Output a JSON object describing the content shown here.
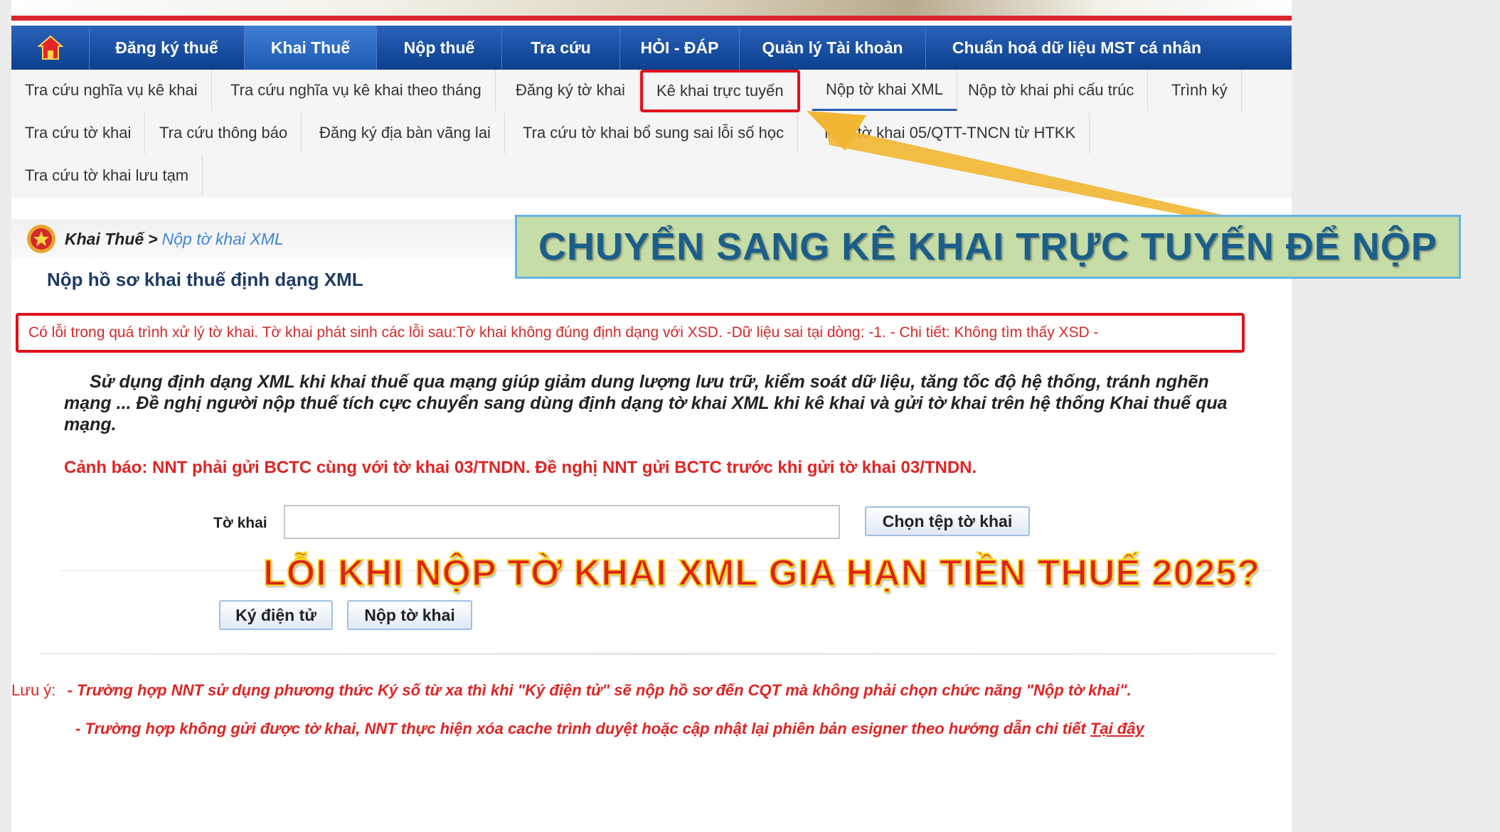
{
  "main_nav": {
    "home_icon": "house-icon",
    "items": [
      {
        "label": "Đăng ký thuế"
      },
      {
        "label": "Khai Thuế"
      },
      {
        "label": "Nộp thuế"
      },
      {
        "label": "Tra cứu"
      },
      {
        "label": "HỎI - ĐÁP"
      },
      {
        "label": "Quản lý Tài khoản"
      },
      {
        "label": "Chuẩn hoá dữ liệu MST cá nhân"
      }
    ]
  },
  "sub_nav": {
    "items": [
      {
        "label": "Tra cứu nghĩa vụ kê khai"
      },
      {
        "label": "Tra cứu nghĩa vụ kê khai theo tháng"
      },
      {
        "label": "Đăng ký tờ khai"
      },
      {
        "label": "Kê khai trực tuyến"
      },
      {
        "label": "Nộp tờ khai XML"
      },
      {
        "label": "Nộp tờ khai phi cấu trúc"
      },
      {
        "label": "Trình ký"
      },
      {
        "label": "Tra cứu tờ khai"
      },
      {
        "label": "Tra cứu thông báo"
      },
      {
        "label": "Đăng ký địa bàn vãng lai"
      },
      {
        "label": "Tra cứu tờ khai bổ sung sai lỗi số học"
      },
      {
        "label": "Nộp tờ khai 05/QTT-TNCN từ HTKK"
      },
      {
        "label": "Tra cứu tờ khai lưu tạm"
      }
    ]
  },
  "breadcrumb": {
    "icon": "emblem-icon",
    "root": "Khai Thuế",
    "separator": ">",
    "current": "Nộp tờ khai XML"
  },
  "page_title": "Nộp hồ sơ khai thuế định dạng XML",
  "error_message": "Có lỗi trong quá trình xử lý tờ khai. Tờ khai phát sinh các lỗi sau:Tờ khai không đúng định dạng với XSD. -Dữ liệu sai tại dòng: -1. - Chi tiết: Không tìm thấy XSD -",
  "description": "Sử dụng định dạng XML khi khai thuế qua mạng giúp giảm dung lượng lưu trữ, kiểm soát dữ liệu, tăng tốc độ hệ thống, tránh nghẽn mạng ... Đề nghị người nộp thuế tích cực chuyển sang dùng định dạng tờ khai XML khi kê khai và gửi tờ khai trên hệ thống Khai thuế qua mạng.",
  "warning": "Cảnh báo: NNT phải gửi BCTC cùng với tờ khai 03/TNDN. Đề nghị NNT gửi BCTC trước khi gửi tờ khai 03/TNDN.",
  "form": {
    "file_label": "Tờ khai",
    "file_value": "",
    "choose_button": "Chọn tệp tờ khai",
    "sign_button": "Ký điện tử",
    "submit_button": "Nộp tờ khai"
  },
  "notes": {
    "label": "Lưu ý:",
    "line1": "- Trường hợp NNT sử dụng phương thức Ký số từ xa thì khi \"Ký điện tử\" sẽ nộp hồ sơ đến CQT mà không phải chọn chức năng \"Nộp tờ khai\".",
    "line2": "- Trường hợp không gửi được tờ khai, NNT thực hiện xóa cache trình duyệt hoặc cập nhật lại phiên bản esigner theo hướng dẫn chi tiết",
    "link": "Tại đây"
  },
  "overlay": {
    "callout": "CHUYỂN SANG KÊ KHAI TRỰC TUYẾN ĐỂ NỘP",
    "headline": "LỖI KHI NỘP TỜ KHAI XML GIA HẠN TIỀN THUẾ 2025?",
    "arrow_color": "#f2b632",
    "callout_bg": "#c7dda8",
    "callout_text_color": "#1b5e8a",
    "headline_color": "#e0201f",
    "headline_outline": "#f7d71c"
  },
  "colors": {
    "nav_blue": "#0c3f8e",
    "accent_red": "#e2111b",
    "link_blue": "#3f86d8",
    "title_navy": "#1f3b66"
  }
}
